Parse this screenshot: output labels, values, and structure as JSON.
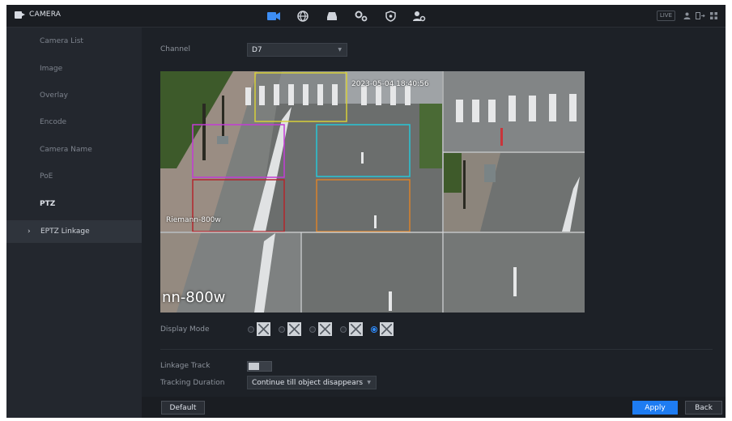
{
  "app": {
    "title": "CAMERA"
  },
  "top_right": {
    "live_label": "LIVE"
  },
  "sidebar": {
    "items": [
      {
        "label": "Camera List"
      },
      {
        "label": "Image"
      },
      {
        "label": "Overlay"
      },
      {
        "label": "Encode"
      },
      {
        "label": "Camera Name"
      },
      {
        "label": "PoE"
      },
      {
        "label": "PTZ"
      },
      {
        "label": "EPTZ Linkage"
      }
    ],
    "active_chevron": "›"
  },
  "form": {
    "channel_label": "Channel",
    "channel_value": "D7",
    "display_mode_label": "Display Mode",
    "display_mode_selected_index": 4,
    "linkage_track_label": "Linkage Track",
    "linkage_track_on": false,
    "tracking_duration_label": "Tracking Duration",
    "tracking_duration_value": "Continue till object disappears"
  },
  "video": {
    "timestamp": "2023-05-04 18:40:56",
    "camera_name_small": "Riemann-800w",
    "camera_name_big": "nn-800w"
  },
  "buttons": {
    "default_label": "Default",
    "apply_label": "Apply",
    "back_label": "Back"
  },
  "colors": {
    "accent": "#1e7cf2",
    "box_yellow": "#d7cf3a",
    "box_magenta": "#c33bd6",
    "box_cyan": "#28c6d6",
    "box_red": "#b3262d",
    "box_orange": "#d9822b"
  },
  "icons": {
    "top_nav": [
      "camera-icon",
      "network-icon",
      "storage-icon",
      "system-icon",
      "security-icon",
      "account-icon"
    ]
  }
}
